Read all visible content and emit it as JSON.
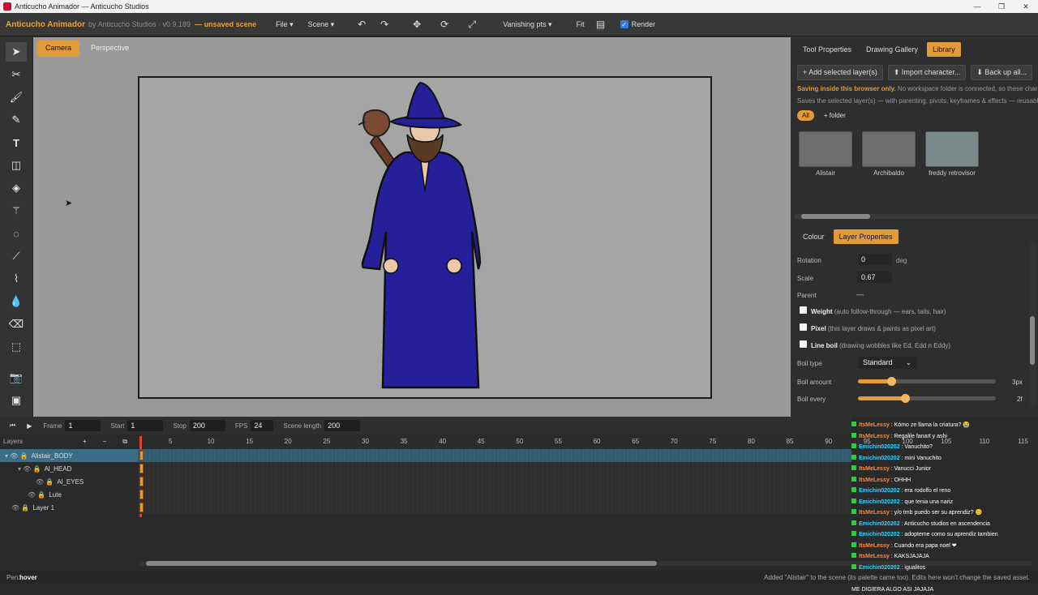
{
  "window": {
    "title": "Anticucho Animador — Anticucho Studios",
    "controls": [
      "minimize-icon",
      "maximize-icon",
      "close-icon"
    ]
  },
  "menubar": {
    "brand": "Anticucho Animador",
    "by": "by Anticucho Studios · v0.9.189",
    "unsaved": "— unsaved scene",
    "file": "File ▾",
    "scene": "Scene ▾",
    "vanishing": "Vanishing pts ▾",
    "fit": "Fit",
    "render": "Render",
    "render_checked": true
  },
  "tools": [
    "select-icon",
    "scissors-icon",
    "brush-icon",
    "pencil-icon",
    "text-icon",
    "shapes-icon",
    "fill-bucket-icon",
    "magic-wand-icon",
    "lasso-icon",
    "bone-icon",
    "smudge-icon",
    "drop-icon",
    "eraser-icon",
    "transform-icon",
    "camera-icon",
    "layers-stack-icon"
  ],
  "viewport": {
    "tabs": [
      "Camera",
      "Perspective"
    ],
    "active_tab": "Camera"
  },
  "right_panel": {
    "tabs": [
      "Tool Properties",
      "Drawing Gallery",
      "Library"
    ],
    "active_tab": "Library",
    "buttons": [
      "+ Add selected layer(s)",
      "⬆ Import character...",
      "⬇ Back up all..."
    ],
    "warning": "Saving inside this browser only.",
    "warning_rest": " No workspace folder is connected, so these chara",
    "desc": "Saves the selected layer(s) — with parenting, pivots, keyframes & effects — reusabl",
    "filters": [
      "All",
      "+ folder"
    ],
    "items": [
      "Alistair",
      "Archibaldo",
      "freddy retrovisor"
    ]
  },
  "props_panel": {
    "tabs": [
      "Colour",
      "Layer Properties"
    ],
    "active_tab": "Layer Properties",
    "rotation_label": "Rotation",
    "rotation": "0",
    "rotation_unit": "deg",
    "scale_label": "Scale",
    "scale": "0.67",
    "parent_label": "Parent",
    "parent": "—",
    "weight": "Weight",
    "weight_note": "(auto follow-through — ears, tails, hair)",
    "pixel": "Pixel",
    "pixel_note": "(this layer draws & paints as pixel art)",
    "lineboil": "Line boil",
    "lineboil_note": "(drawing wobbles like Ed, Edd n Eddy)",
    "boiltype_label": "Boil type",
    "boiltype": "Standard",
    "boilamount_label": "Boil amount",
    "boilamount": "3px",
    "boilamount_frac": 0.24,
    "boilevery_label": "Boil every",
    "boilevery": "2f",
    "boilevery_frac": 0.34
  },
  "timeline": {
    "frame_label": "Frame",
    "frame": "1",
    "start_label": "Start",
    "start": "1",
    "stop_label": "Stop",
    "stop": "200",
    "fps_label": "FPS",
    "fps": "24",
    "length_label": "Scene length",
    "length": "200",
    "layers_label": "Layers",
    "ticks": [
      "5",
      "10",
      "15",
      "20",
      "25",
      "30",
      "35",
      "40",
      "45",
      "50",
      "55",
      "60",
      "65",
      "70",
      "75",
      "80",
      "85",
      "90",
      "95",
      "100",
      "105",
      "110",
      "115"
    ],
    "layers": [
      "Alistair_BODY",
      "Al_HEAD",
      "Al_EYES",
      "Lute",
      "Layer 1"
    ]
  },
  "chat": [
    {
      "user": "ItsMeLessy",
      "text": ": Kómo ze llama la criatura? 😭",
      "c": "u2"
    },
    {
      "user": "ItsMeLessy",
      "text": ": Regalile fanart y ashi",
      "c": "u2"
    },
    {
      "user": "Emichin020202",
      "text": ": Vanuchito?",
      "c": "u1"
    },
    {
      "user": "Emichin020202",
      "text": ": mini Vanuchito",
      "c": "u1"
    },
    {
      "user": "ItsMeLessy",
      "text": ": Vanucci Junior",
      "c": "u2"
    },
    {
      "user": "ItsMeLessy",
      "text": ": OHHH",
      "c": "u2"
    },
    {
      "user": "Emichin020202",
      "text": ": era rodolfo el reno",
      "c": "u1"
    },
    {
      "user": "Emichin020202",
      "text": ": que tenia una nariz",
      "c": "u1"
    },
    {
      "user": "ItsMeLessy",
      "text": ": y/o tmb puedo ser su aprendiz? 😊",
      "c": "u2"
    },
    {
      "user": "Emichin020202",
      "text": ": Anticucho studios en ascendencia",
      "c": "u1"
    },
    {
      "user": "Emichin020202",
      "text": ": adopteme como su aprendiz tambien",
      "c": "u1"
    },
    {
      "user": "ItsMeLessy",
      "text": ": Cuando era papa noel ❤",
      "c": "u2"
    },
    {
      "user": "ItsMeLessy",
      "text": ": KAKSJAJAJA",
      "c": "u2"
    },
    {
      "user": "Emichin020202",
      "text": ": igualitos",
      "c": "u1"
    },
    {
      "user": "Emichin020202",
      "text": ": AAAAAAH NOMAS ESPERABA QUE",
      "c": "u1"
    }
  ],
  "chat_last": "ME DIGIERA ALGO ASI JAJAJA",
  "status": {
    "pen_label": "Pen:",
    "pen": "hover",
    "message": "Added \"Alistair\" to the scene (its palette came too). Edits here won't change the saved asset."
  },
  "colors": {
    "accent": "#e39b3a",
    "robe": "#25209a",
    "brand": "#e8a23b"
  }
}
